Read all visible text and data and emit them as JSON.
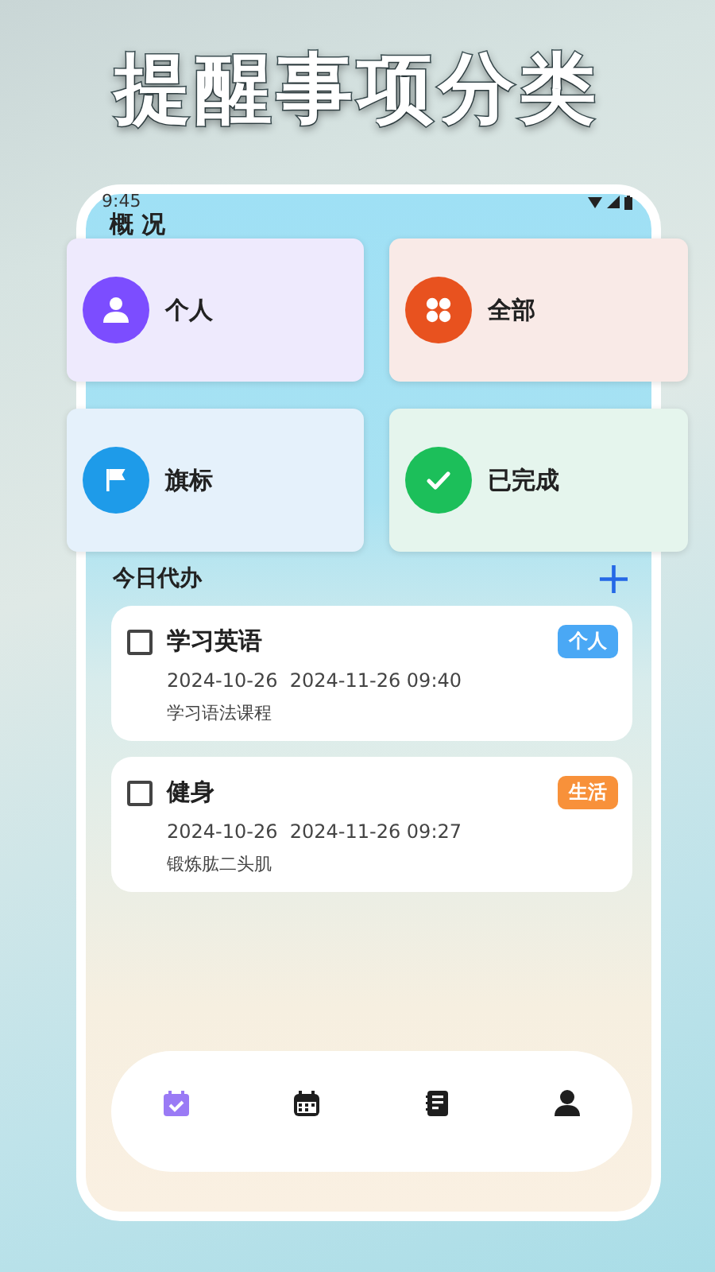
{
  "headline": "提醒事项分类",
  "status_bar": {
    "time": "9:45"
  },
  "page_title": "概 况",
  "categories": [
    {
      "label": "个人",
      "kind": "person",
      "color": "#7c4dff"
    },
    {
      "label": "全部",
      "kind": "grid",
      "color": "#e8521f"
    },
    {
      "label": "旗标",
      "kind": "flag",
      "color": "#1e9be9"
    },
    {
      "label": "已完成",
      "kind": "check",
      "color": "#1cbf5a"
    }
  ],
  "section": {
    "title": "今日代办",
    "add": "+"
  },
  "tasks": [
    {
      "title": "学习英语",
      "checked": false,
      "dates": "2024-10-26  2024-11-26 09:40",
      "note": "学习语法课程",
      "tag": "个人",
      "color": "#4aa8f5"
    },
    {
      "title": "健身",
      "checked": false,
      "dates": "2024-10-26  2024-11-26 09:27",
      "note": "锻炼肱二头肌",
      "tag": "生活",
      "color": "#f8913a"
    }
  ],
  "nav": [
    {
      "kind": "todo",
      "selected": true
    },
    {
      "kind": "calendar",
      "selected": false
    },
    {
      "kind": "notebook",
      "selected": false
    },
    {
      "kind": "profile",
      "selected": false
    }
  ]
}
